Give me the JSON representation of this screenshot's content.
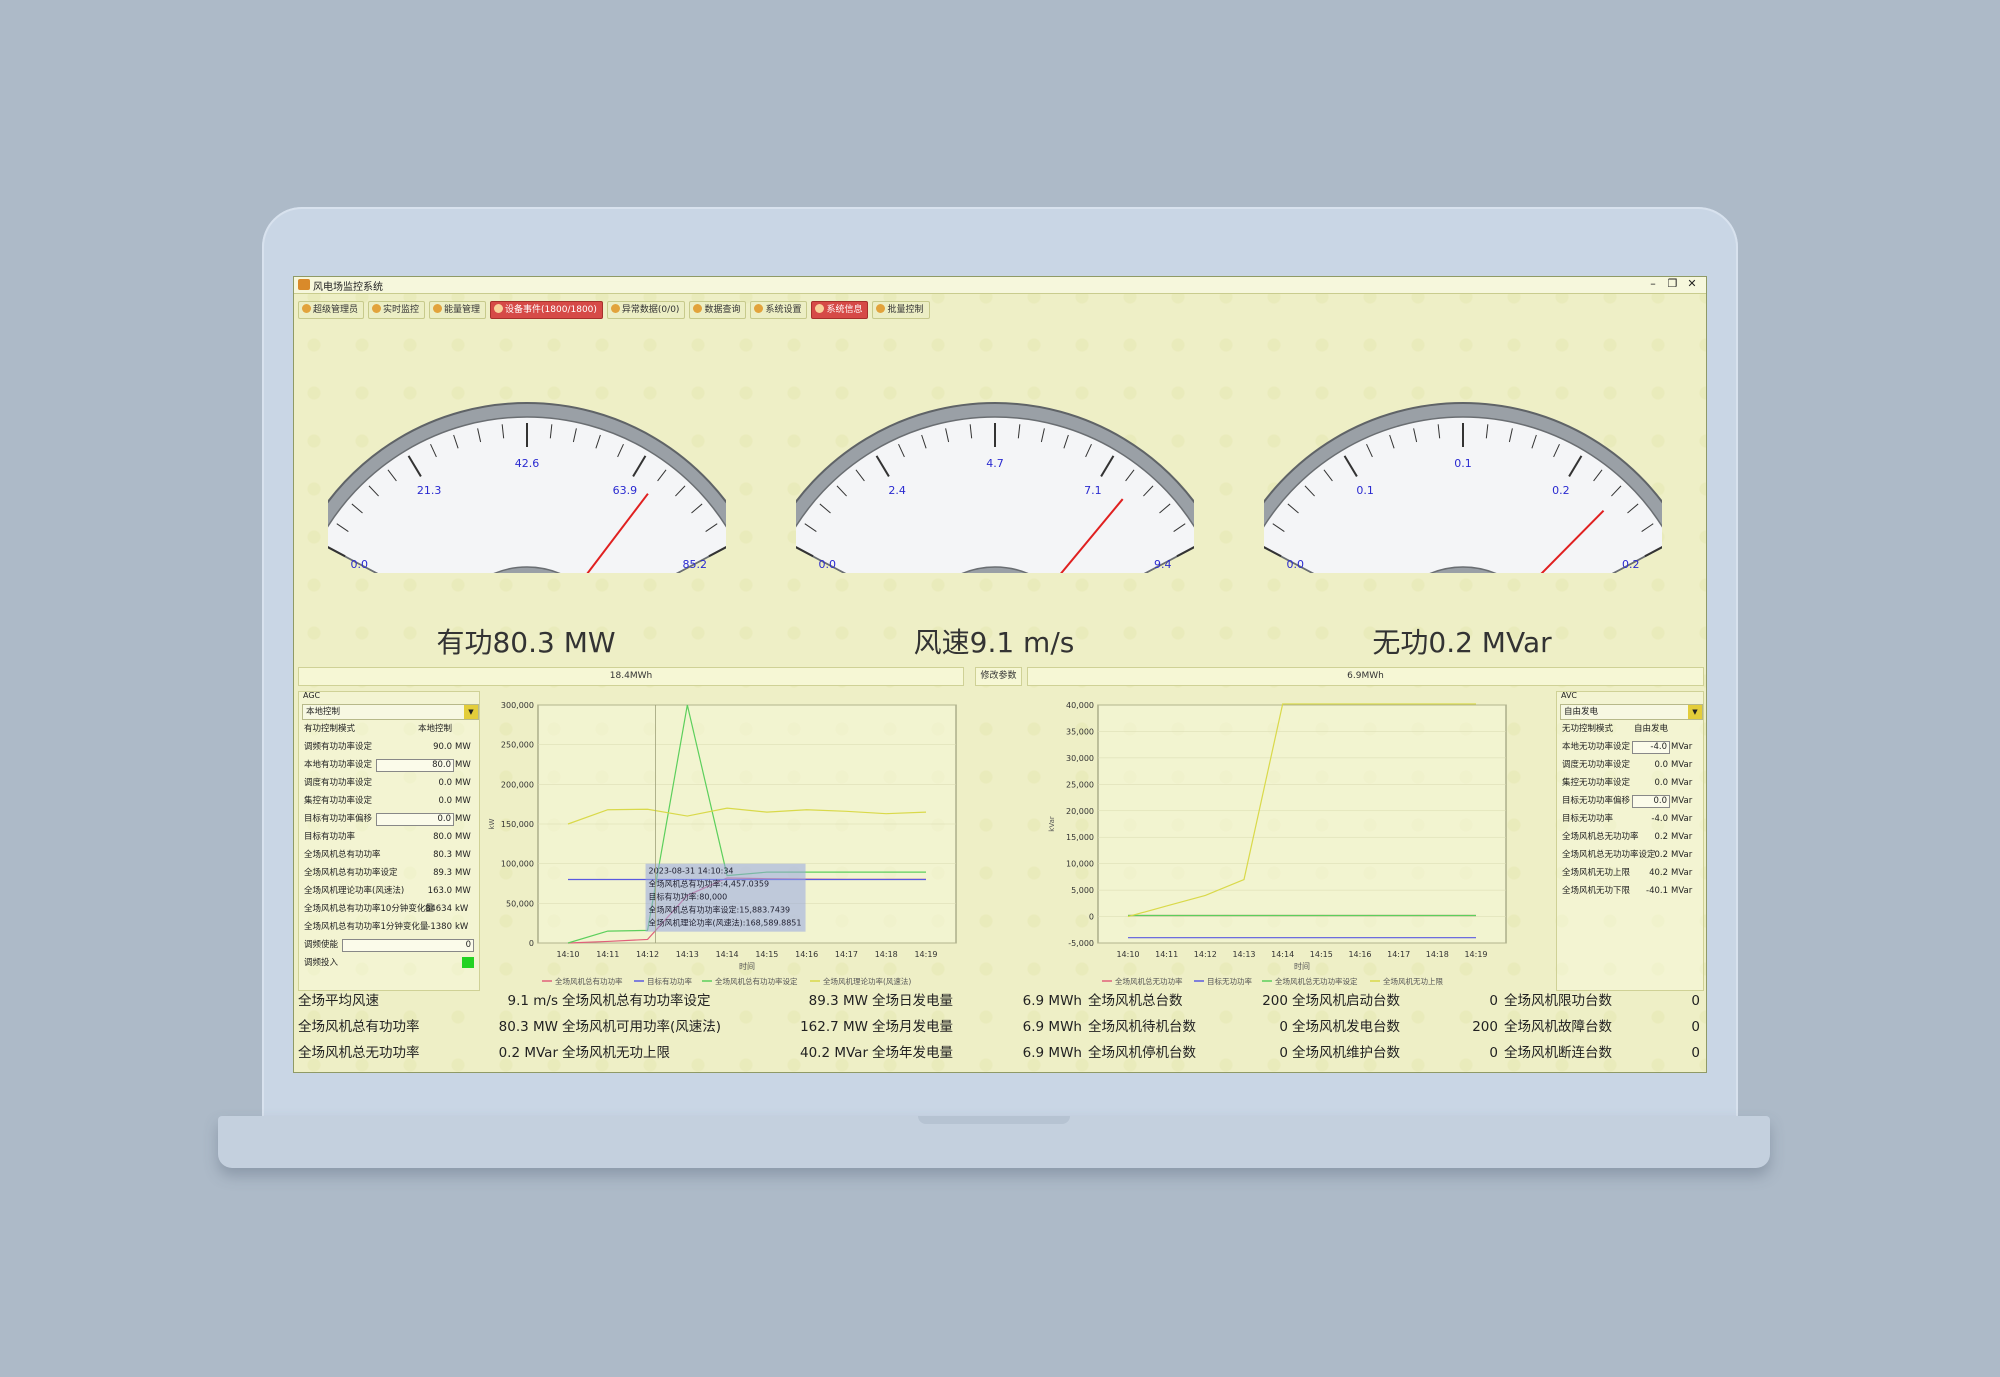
{
  "app": {
    "title": "风电场监控系统",
    "min": "–",
    "restore": "❐",
    "close": "✕"
  },
  "toolbar": [
    {
      "label": "超级管理员",
      "highlight": false
    },
    {
      "label": "实时监控",
      "highlight": false
    },
    {
      "label": "能量管理",
      "highlight": false
    },
    {
      "label": "设备事件(1800/1800)",
      "highlight": true
    },
    {
      "label": "异常数据(0/0)",
      "highlight": false
    },
    {
      "label": "数据查询",
      "highlight": false
    },
    {
      "label": "系统设置",
      "highlight": false
    },
    {
      "label": "系统信息",
      "highlight": true
    },
    {
      "label": "批量控制",
      "highlight": false
    }
  ],
  "gauges": [
    {
      "ticks": [
        "0.0",
        "21.3",
        "42.6",
        "63.9",
        "85.2"
      ],
      "needle_fraction": 0.8,
      "label": "有功80.3 MW"
    },
    {
      "ticks": [
        "0.0",
        "2.4",
        "4.7",
        "7.1",
        "9.4"
      ],
      "needle_fraction": 0.82,
      "label": "风速9.1 m/s"
    },
    {
      "ticks": [
        "0.0",
        "0.1",
        "0.1",
        "0.2",
        "0.2"
      ],
      "needle_fraction": 0.86,
      "label": "无功0.2 MVar"
    }
  ],
  "info": {
    "left": "18.4MWh",
    "button": "修改参数",
    "right": "6.9MWh"
  },
  "agc": {
    "title": "AGC",
    "mode_select": "本地控制",
    "rows": [
      {
        "label": "有功控制模式",
        "value": "本地控制",
        "input": false
      },
      {
        "label": "调频有功功率设定",
        "value": "90.0",
        "unit": "MW",
        "input": false
      },
      {
        "label": "本地有功功率设定",
        "value": "80.0",
        "unit": "MW",
        "input": true
      },
      {
        "label": "调度有功功率设定",
        "value": "0.0",
        "unit": "MW",
        "input": false
      },
      {
        "label": "集控有功功率设定",
        "value": "0.0",
        "unit": "MW",
        "input": false
      },
      {
        "label": "目标有功功率偏移",
        "value": "0.0",
        "unit": "MW",
        "input": true
      },
      {
        "label": "目标有功功率",
        "value": "80.0",
        "unit": "MW",
        "input": false
      },
      {
        "label": "全场风机总有功功率",
        "value": "80.3",
        "unit": "MW",
        "input": false
      },
      {
        "label": "全场风机总有功功率设定",
        "value": "89.3",
        "unit": "MW",
        "input": false
      },
      {
        "label": "全场风机理论功率(风速法)",
        "value": "163.0",
        "unit": "MW",
        "input": false
      },
      {
        "label": "全场风机总有功功率10分钟变化量",
        "value": "84634",
        "unit": "kW",
        "input": false
      },
      {
        "label": "全场风机总有功功率1分钟变化量",
        "value": "-1380",
        "unit": "kW",
        "input": false
      },
      {
        "label": "调频使能",
        "value": "0",
        "input": "wide"
      },
      {
        "label": "调频投入",
        "value": "",
        "indicator": true
      }
    ]
  },
  "avc": {
    "title": "AVC",
    "mode_select": "自由发电",
    "rows": [
      {
        "label": "无功控制模式",
        "value": "自由发电",
        "input": false
      },
      {
        "label": "本地无功功率设定",
        "value": "-4.0",
        "unit": "MVar",
        "input": true
      },
      {
        "label": "调度无功功率设定",
        "value": "0.0",
        "unit": "MVar",
        "input": false
      },
      {
        "label": "集控无功功率设定",
        "value": "0.0",
        "unit": "MVar",
        "input": false
      },
      {
        "label": "目标无功功率偏移",
        "value": "0.0",
        "unit": "MVar",
        "input": true
      },
      {
        "label": "目标无功功率",
        "value": "-4.0",
        "unit": "MVar",
        "input": false
      },
      {
        "label": "全场风机总无功功率",
        "value": "0.2",
        "unit": "MVar",
        "input": false
      },
      {
        "label": "全场风机总无功功率设定",
        "value": "0.2",
        "unit": "MVar",
        "input": false
      },
      {
        "label": "全场风机无功上限",
        "value": "40.2",
        "unit": "MVar",
        "input": false
      },
      {
        "label": "全场风机无功下限",
        "value": "-40.1",
        "unit": "MVar",
        "input": false
      }
    ]
  },
  "chart_data": [
    {
      "type": "line",
      "x": [
        "14:10",
        "14:11",
        "14:12",
        "14:13",
        "14:14",
        "14:15",
        "14:16",
        "14:17",
        "14:18",
        "14:19"
      ],
      "xlabel": "时间",
      "ylabel": "kW",
      "ylim": [
        0,
        300000
      ],
      "yticks": [
        "0",
        "50,000",
        "100,000",
        "150,000",
        "200,000",
        "250,000",
        "300,000"
      ],
      "series": [
        {
          "name": "全场风机总有功功率",
          "color": "#e0607a",
          "values": [
            0,
            2000,
            4457,
            60000,
            82000,
            81000,
            80500,
            80300,
            80300,
            80300
          ]
        },
        {
          "name": "目标有功功率",
          "color": "#5a5ae0",
          "values": [
            80000,
            80000,
            80000,
            80000,
            80000,
            80000,
            80000,
            80000,
            80000,
            80000
          ]
        },
        {
          "name": "全场风机总有功功率设定",
          "color": "#5ccf5c",
          "values": [
            0,
            15000,
            15883,
            300000,
            85000,
            89300,
            89300,
            89300,
            89300,
            89300
          ]
        },
        {
          "name": "全场风机理论功率(风速法)",
          "color": "#d9d94a",
          "values": [
            150000,
            168000,
            168590,
            160000,
            170000,
            165000,
            168000,
            166000,
            163000,
            165000
          ]
        }
      ],
      "tooltip": [
        "2023-08-31 14:10:34",
        "全场风机总有功功率:4,457.0359",
        "目标有功功率:80,000",
        "全场风机总有功功率设定:15,883.7439",
        "全场风机理论功率(风速法):168,589.8851"
      ]
    },
    {
      "type": "line",
      "x": [
        "14:10",
        "14:11",
        "14:12",
        "14:13",
        "14:14",
        "14:15",
        "14:16",
        "14:17",
        "14:18",
        "14:19"
      ],
      "xlabel": "时间",
      "ylabel": "kVar",
      "ylim": [
        -5000,
        40000
      ],
      "yticks": [
        "-5,000",
        "0",
        "5,000",
        "10,000",
        "15,000",
        "20,000",
        "25,000",
        "30,000",
        "35,000",
        "40,000"
      ],
      "series": [
        {
          "name": "全场风机总无功功率",
          "color": "#e0607a",
          "values": [
            200,
            200,
            200,
            200,
            200,
            200,
            200,
            200,
            200,
            200
          ]
        },
        {
          "name": "目标无功功率",
          "color": "#5a5ae0",
          "values": [
            -4000,
            -4000,
            -4000,
            -4000,
            -4000,
            -4000,
            -4000,
            -4000,
            -4000,
            -4000
          ]
        },
        {
          "name": "全场风机总无功功率设定",
          "color": "#5ccf5c",
          "values": [
            200,
            200,
            200,
            200,
            200,
            200,
            200,
            200,
            200,
            200
          ]
        },
        {
          "name": "全场风机无功上限",
          "color": "#d9d94a",
          "values": [
            0,
            2000,
            4000,
            7000,
            40200,
            40200,
            40200,
            40200,
            40200,
            40200
          ]
        }
      ]
    }
  ],
  "stats": [
    [
      {
        "label": "全场平均风速",
        "value": "9.1 m/s"
      },
      {
        "label": "全场风机总有功功率设定",
        "value": "89.3 MW"
      },
      {
        "label": "全场日发电量",
        "value": "6.9 MWh"
      },
      {
        "label": "全场风机总台数",
        "value": "200"
      },
      {
        "label": "全场风机启动台数",
        "value": "0"
      },
      {
        "label": "全场风机限功台数",
        "value": "0"
      }
    ],
    [
      {
        "label": "全场风机总有功功率",
        "value": "80.3 MW"
      },
      {
        "label": "全场风机可用功率(风速法)",
        "value": "162.7 MW"
      },
      {
        "label": "全场月发电量",
        "value": "6.9 MWh"
      },
      {
        "label": "全场风机待机台数",
        "value": "0"
      },
      {
        "label": "全场风机发电台数",
        "value": "200"
      },
      {
        "label": "全场风机故障台数",
        "value": "0"
      }
    ],
    [
      {
        "label": "全场风机总无功功率",
        "value": "0.2 MVar"
      },
      {
        "label": "全场风机无功上限",
        "value": "40.2 MVar"
      },
      {
        "label": "全场年发电量",
        "value": "6.9 MWh"
      },
      {
        "label": "全场风机停机台数",
        "value": "0"
      },
      {
        "label": "全场风机维护台数",
        "value": "0"
      },
      {
        "label": "全场风机断连台数",
        "value": "0"
      }
    ]
  ]
}
